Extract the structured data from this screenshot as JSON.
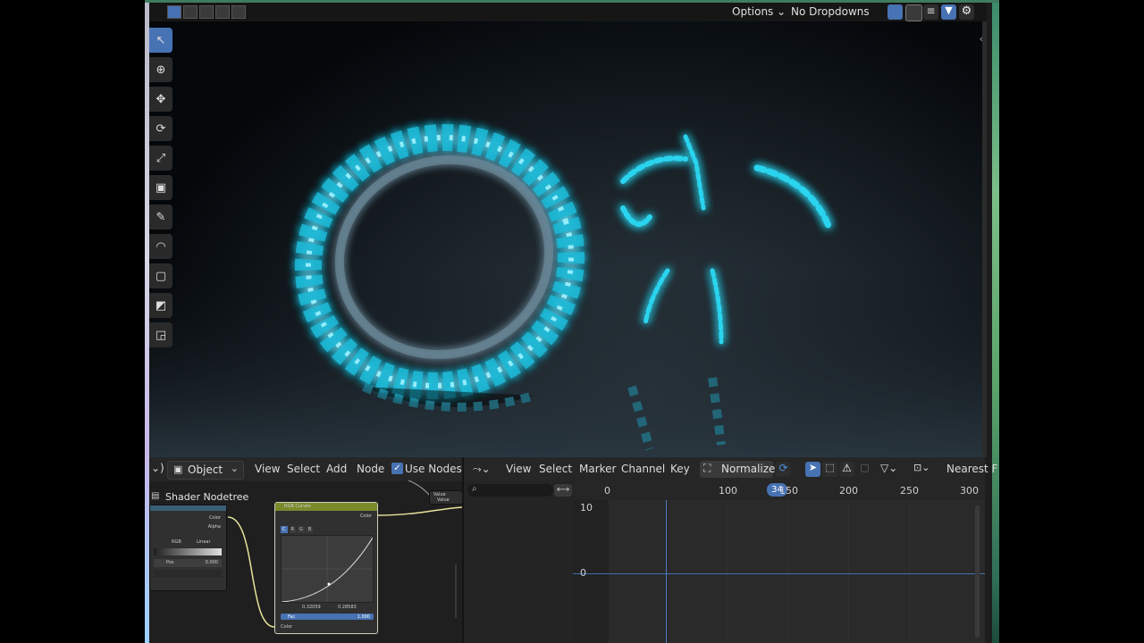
{
  "viewport_header": {
    "options_label": "Options",
    "dropdowns_label": "No Dropdowns"
  },
  "node_editor": {
    "object_mode": "Object",
    "menu": [
      "View",
      "Select",
      "Add",
      "Node"
    ],
    "use_nodes_label": "Use Nodes",
    "tree_name": "Shader Nodetree",
    "nodes": {
      "left_outputs": [
        "Color",
        "Alpha"
      ],
      "left_fields": [
        "RGB",
        "Linear",
        "Pos",
        "0.000"
      ],
      "curves_title": "RGB Curves",
      "curves_output": "Color",
      "curves_tabs": [
        "C",
        "R",
        "G",
        "B"
      ],
      "curves_values": [
        "0.32059",
        "0.28583"
      ],
      "fac_label": "Fac",
      "fac_value": "1.000",
      "curves_input": "Color",
      "small_node_rows": [
        "Value",
        "Value"
      ]
    }
  },
  "graph_editor": {
    "menu": [
      "View",
      "Select",
      "Marker",
      "Channel",
      "Key"
    ],
    "normalize_label": "Normalize",
    "interp_label": "Nearest F",
    "frame_ticks": [
      "0",
      "100",
      "150",
      "200",
      "250",
      "300"
    ],
    "current_frame": "34",
    "y_labels": [
      "10",
      "0"
    ]
  },
  "colors": {
    "accent": "#4772b3",
    "glow": "#4de0f5",
    "curves_header": "#7b8a2b"
  }
}
